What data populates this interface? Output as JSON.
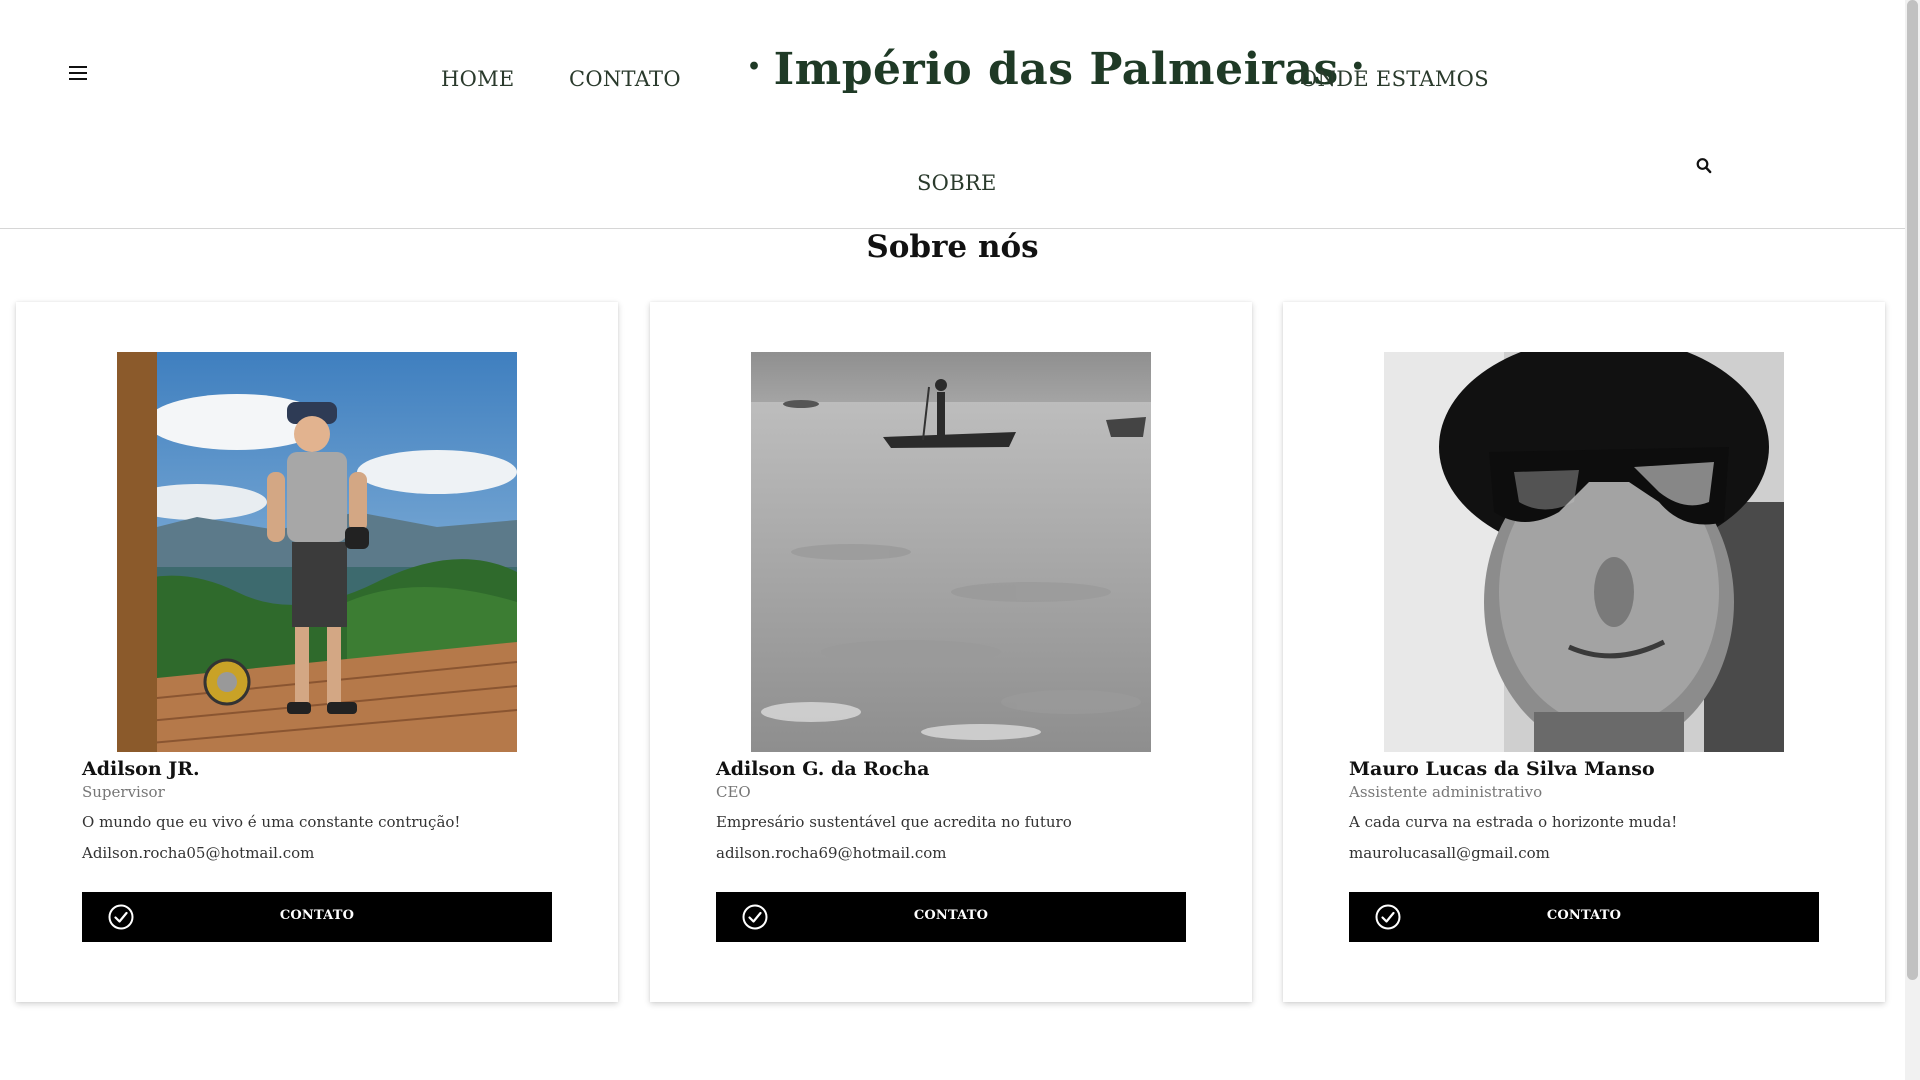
{
  "header": {
    "brand": "Império das Palmeiras",
    "brand_dot": "•",
    "nav": {
      "home": "HOME",
      "contato": "CONTATO",
      "onde_estamos": "ONDE ESTAMOS",
      "sobre": "SOBRE"
    }
  },
  "main": {
    "title": "Sobre nós"
  },
  "cards": [
    {
      "name": "Adilson JR.",
      "role": "Supervisor",
      "quote": "O mundo que eu vivo é uma constante contrução!",
      "email": "Adilson.rocha05@hotmail.com",
      "button_label": "CONTATO"
    },
    {
      "name": "Adilson G. da Rocha",
      "role": "CEO",
      "quote": "Empresário sustentável que acredita no futuro",
      "email": "adilson.rocha69@hotmail.com",
      "button_label": "CONTATO"
    },
    {
      "name": "Mauro Lucas da Silva Manso",
      "role": "Assistente administrativo",
      "quote": "A cada curva na estrada o horizonte muda!",
      "email": "maurolucasall@gmail.com",
      "button_label": "CONTATO"
    }
  ],
  "icons": {
    "menu": "hamburger-icon",
    "search": "search-icon",
    "button": "check-circle-icon"
  },
  "colors": {
    "brand": "#1f3a26",
    "nav_text": "#2a3a2c",
    "button_bg": "#000000",
    "button_text": "#ffffff"
  }
}
